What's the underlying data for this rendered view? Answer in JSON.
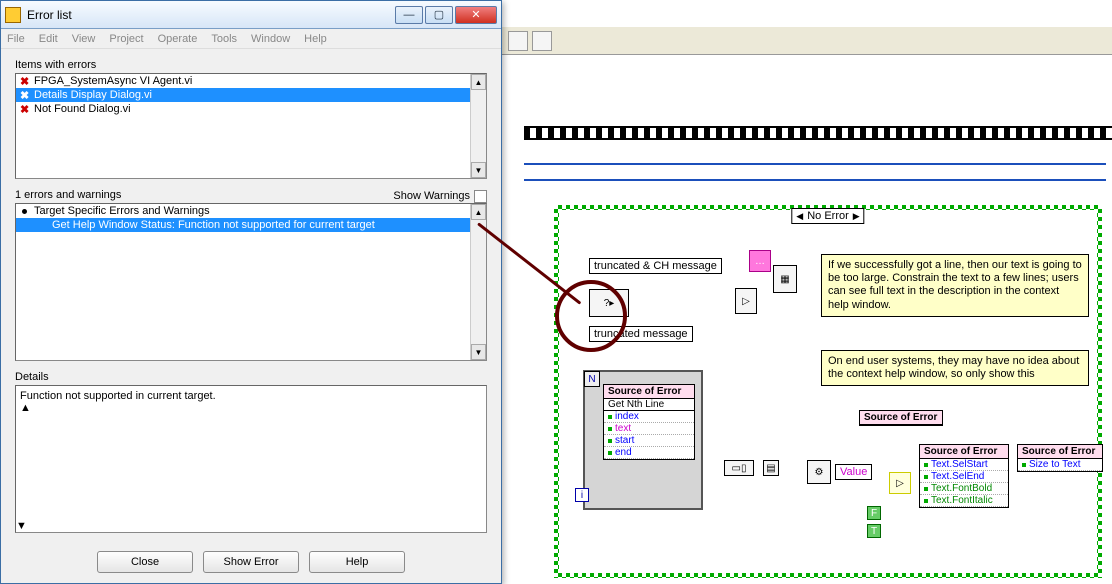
{
  "dialog": {
    "title": "Error list",
    "menu": [
      "File",
      "Edit",
      "View",
      "Project",
      "Operate",
      "Tools",
      "Window",
      "Help"
    ],
    "items_label": "Items with errors",
    "error_items": [
      {
        "label": "FPGA_SystemAsync VI Agent.vi",
        "selected": false
      },
      {
        "label": "Details Display Dialog.vi",
        "selected": true
      },
      {
        "label": "Not Found Dialog.vi",
        "selected": false
      }
    ],
    "warnings_count_label": "1 errors and warnings",
    "show_warnings_label": "Show Warnings",
    "warning_items": [
      {
        "label": "Target Specific Errors and Warnings",
        "indent": 0,
        "bullet": true,
        "selected": false
      },
      {
        "label": "Get Help Window Status: Function not supported for current target",
        "indent": 1,
        "bullet": false,
        "selected": true
      }
    ],
    "details_label": "Details",
    "details_text": "Function not supported in current target.",
    "buttons": {
      "close": "Close",
      "show_error": "Show Error",
      "help": "Help"
    }
  },
  "diagram": {
    "selector_label": "No Error",
    "label_truncated_ch": "truncated & CH message",
    "label_truncated": "truncated message",
    "comment1": "If we successfully got a line, then our text is going to be too large. Constrain the text to a few lines; users can see full text in the description in the context help window.",
    "comment2_a": "On end user systems, they may have no idea about",
    "comment2_b": "the context help window, so only show this",
    "cluster1": {
      "head": "Source of Error",
      "sub": "Get Nth Line",
      "rows": [
        "index",
        "text",
        "start",
        "end"
      ]
    },
    "node_value": "Value",
    "node_sof_label": "Source of Error",
    "props": [
      "Text.SelStart",
      "Text.SelEnd",
      "Text.FontBold",
      "Text.FontItalic"
    ],
    "size_to_text": "Size to Text",
    "bool_f": "F",
    "bool_t": "T"
  }
}
